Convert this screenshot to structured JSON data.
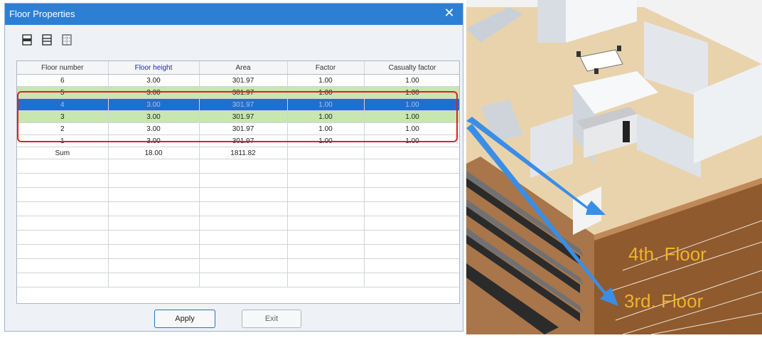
{
  "dialog": {
    "title": "Floor Properties",
    "close_glyph": "✕",
    "toolbar": {
      "icons": [
        "insert-row-icon",
        "insert-rows-icon",
        "grid-icon"
      ]
    },
    "table": {
      "headers": [
        "Floor number",
        "Floor height",
        "Area",
        "Factor",
        "Casualty factor"
      ],
      "rows": [
        [
          "6",
          "3.00",
          "301.97",
          "1.00",
          "1.00"
        ],
        [
          "5",
          "3.00",
          "301.97",
          "1.00",
          "1.00"
        ],
        [
          "4",
          "3.00",
          "301.97",
          "1.00",
          "1.00"
        ],
        [
          "3",
          "3.00",
          "301.97",
          "1.00",
          "1.00"
        ],
        [
          "2",
          "3.00",
          "301.97",
          "1.00",
          "1.00"
        ],
        [
          "1",
          "3.00",
          "301.97",
          "1.00",
          "1.00"
        ],
        [
          "Sum",
          "18.00",
          "1811.82",
          "",
          ""
        ]
      ]
    },
    "buttons": {
      "apply": "Apply",
      "exit": "Exit"
    }
  },
  "building_view": {
    "label_4th": "4th. Floor",
    "label_3rd": "3rd. Floor"
  },
  "colors": {
    "titlebar": "#2d7fd4",
    "selected_row": "#1f6fd3",
    "highlight_row": "#c8e6b0",
    "selection_outline": "#e02020",
    "arrow": "#3a8ee6",
    "floor_label": "#f0b429"
  }
}
